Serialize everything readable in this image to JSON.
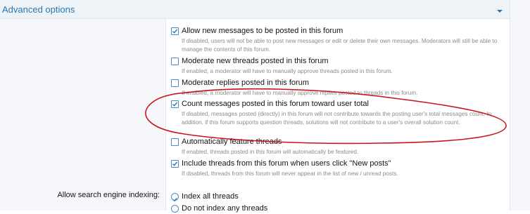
{
  "panel": {
    "title": "Advanced options"
  },
  "options": [
    {
      "label": "Allow new messages to be posted in this forum",
      "checked": true,
      "description": "If disabled, users will not be able to post new messages or edit or delete their own messages. Moderators will still be able to manage the contents of this forum."
    },
    {
      "label": "Moderate new threads posted in this forum",
      "checked": false,
      "description": "If enabled, a moderator will have to manually approve threads posted in this forum."
    },
    {
      "label": "Moderate replies posted in this forum",
      "checked": false,
      "description": "If enabled, a moderator will have to manually approve replies posted to threads in this forum."
    },
    {
      "label": "Count messages posted in this forum toward user total",
      "checked": true,
      "description": "If disabled, messages posted (directly) in this forum will not contribute towards the posting user's total messages count. In addition, if this forum supports question threads, solutions will not contribute to a user's overall solution count."
    },
    {
      "label": "Automatically feature threads",
      "checked": false,
      "description": "If enabled, threads posted in this forum will automatically be featured."
    },
    {
      "label": "Include threads from this forum when users click \"New posts\"",
      "checked": true,
      "description": "If disabled, threads from this forum will never appear in the list of new / unread posts."
    }
  ],
  "search_indexing": {
    "label": "Allow search engine indexing:",
    "choices": [
      {
        "label": "Index all threads",
        "selected": true
      },
      {
        "label": "Do not index any threads",
        "selected": false
      }
    ]
  },
  "colors": {
    "accent": "#2577b1",
    "annotation": "#c8141e"
  }
}
